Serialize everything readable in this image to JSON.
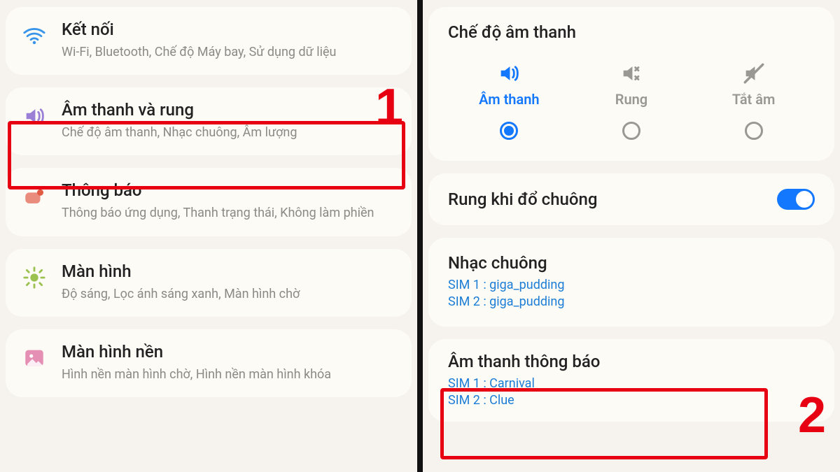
{
  "left": {
    "items": [
      {
        "title": "Kết nối",
        "sub": "Wi-Fi, Bluetooth, Chế độ Máy bay, Sử dụng dữ liệu"
      },
      {
        "title": "Âm thanh và rung",
        "sub": "Chế độ âm thanh, Nhạc chuông, Âm lượng"
      },
      {
        "title": "Thông báo",
        "sub": "Thông báo ứng dụng, Thanh trạng thái, Không làm phiền"
      },
      {
        "title": "Màn hình",
        "sub": "Độ sáng, Lọc ánh sáng xanh, Màn hình chờ"
      },
      {
        "title": "Màn hình nền",
        "sub": "Hình nền màn hình chờ, Hình nền màn hình khóa"
      }
    ],
    "step": "1"
  },
  "right": {
    "sound_mode_title": "Chế độ âm thanh",
    "modes": [
      {
        "label": "Âm thanh",
        "selected": true
      },
      {
        "label": "Rung",
        "selected": false
      },
      {
        "label": "Tắt âm",
        "selected": false
      }
    ],
    "vibrate_while_ringing": "Rung khi đổ chuông",
    "ringtone": {
      "title": "Nhạc chuông",
      "sim1": "SIM 1 : giga_pudding",
      "sim2": "SIM 2 : giga_pudding"
    },
    "notification_sound": {
      "title": "Âm thanh thông báo",
      "sim1": "SIM 1 : Carnival",
      "sim2": "SIM 2 : Clue"
    },
    "step": "2"
  }
}
